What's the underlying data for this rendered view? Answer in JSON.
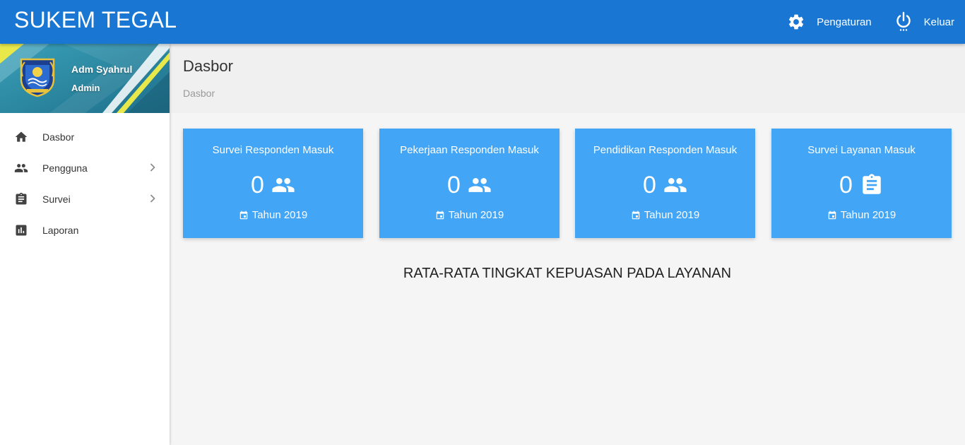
{
  "app": {
    "title": "SUKEM TEGAL"
  },
  "topnav": {
    "settings": {
      "label": "Pengaturan",
      "icon": "gear-icon"
    },
    "logout": {
      "label": "Keluar",
      "icon": "power-icon"
    }
  },
  "profile": {
    "name": "Adm Syahrul",
    "role": "Admin"
  },
  "sidebar": {
    "items": [
      {
        "label": "Dasbor",
        "icon": "home-icon",
        "has_submenu": false
      },
      {
        "label": "Pengguna",
        "icon": "people-icon",
        "has_submenu": true
      },
      {
        "label": "Survei",
        "icon": "clipboard-icon",
        "has_submenu": true
      },
      {
        "label": "Laporan",
        "icon": "bar-chart-icon",
        "has_submenu": false
      }
    ]
  },
  "page": {
    "title": "Dasbor",
    "breadcrumb": "Dasbor"
  },
  "cards": [
    {
      "title": "Survei Responden Masuk",
      "count": "0",
      "icon": "people-icon",
      "footer": "Tahun 2019"
    },
    {
      "title": "Pekerjaan Responden Masuk",
      "count": "0",
      "icon": "people-icon",
      "footer": "Tahun 2019"
    },
    {
      "title": "Pendidikan Responden Masuk",
      "count": "0",
      "icon": "people-icon",
      "footer": "Tahun 2019"
    },
    {
      "title": "Survei Layanan Masuk",
      "count": "0",
      "icon": "clipboard-icon",
      "footer": "Tahun 2019"
    }
  ],
  "section": {
    "title": "RATA-RATA TINGKAT KEPUASAN PADA LAYANAN"
  },
  "colors": {
    "topbar": "#1976d2",
    "card": "#42a5f5",
    "background": "#f5f5f5"
  }
}
